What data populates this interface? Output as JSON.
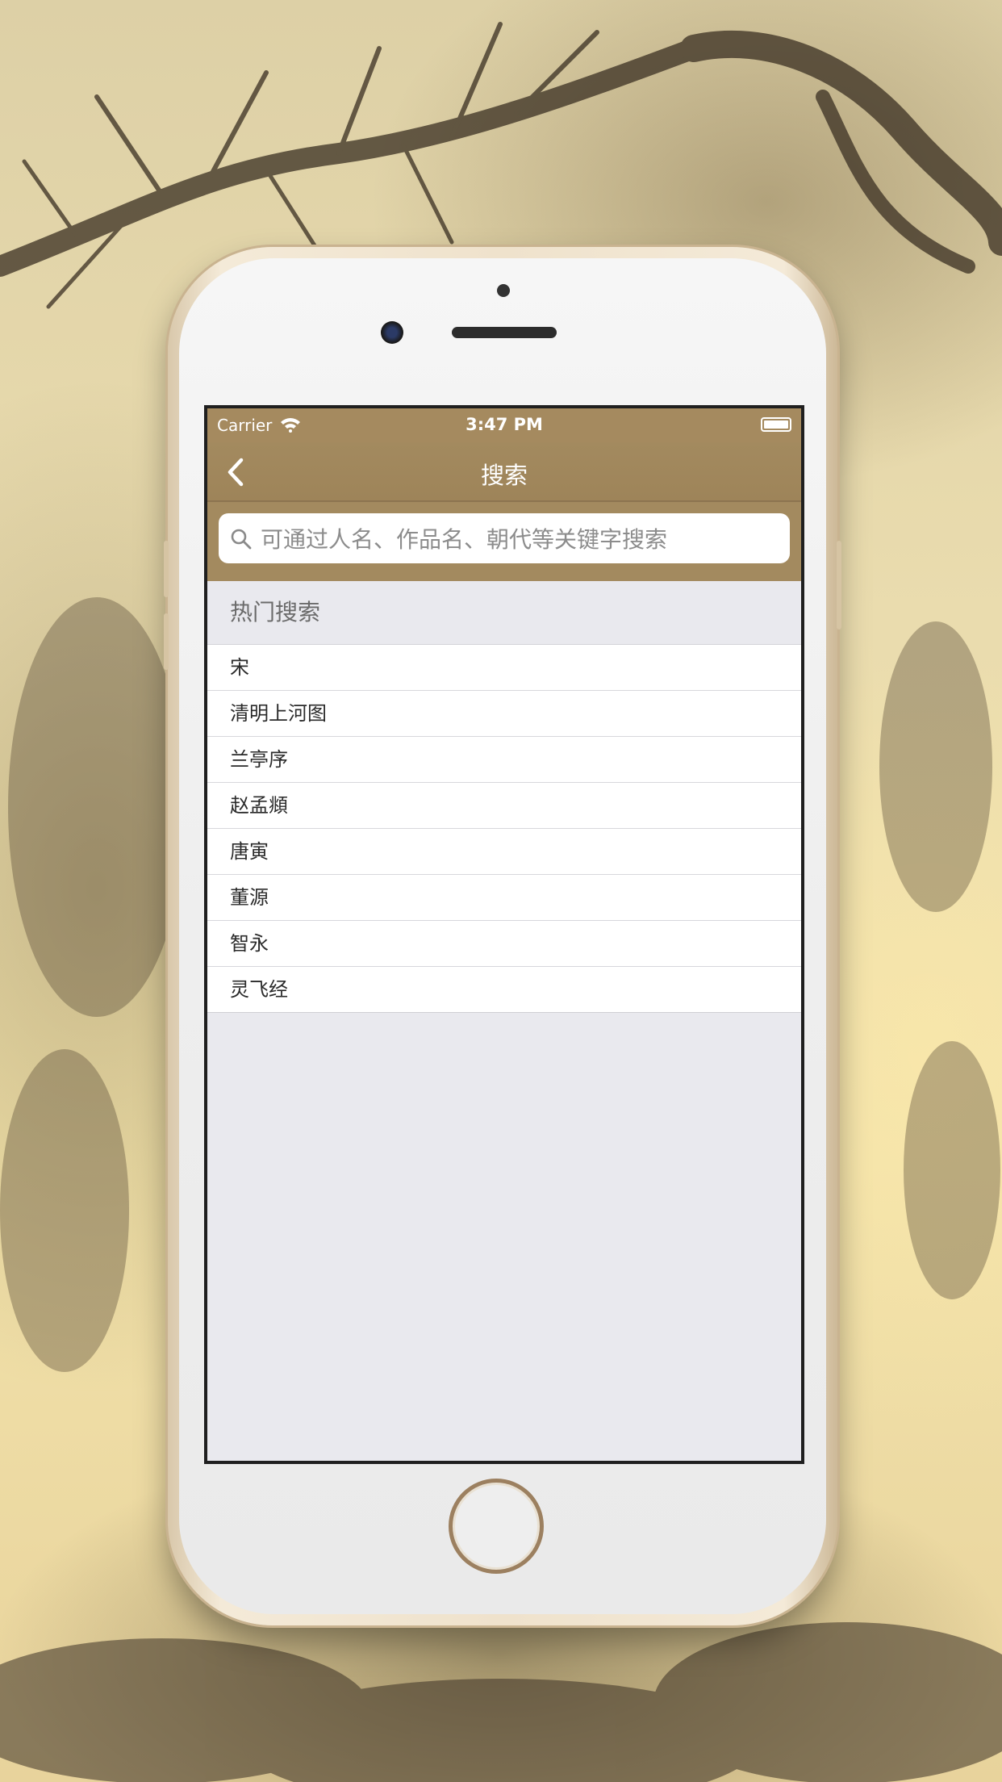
{
  "status_bar": {
    "carrier": "Carrier",
    "time": "3:47 PM"
  },
  "nav": {
    "title": "搜索",
    "back_icon": "chevron-left-icon"
  },
  "search": {
    "placeholder": "可通过人名、作品名、朝代等关键字搜索",
    "value": "",
    "icon": "search-icon"
  },
  "hot_section": {
    "title": "热门搜索",
    "items": [
      {
        "label": "宋"
      },
      {
        "label": "清明上河图"
      },
      {
        "label": "兰亭序"
      },
      {
        "label": "赵孟頫"
      },
      {
        "label": "唐寅"
      },
      {
        "label": "董源"
      },
      {
        "label": "智永"
      },
      {
        "label": "灵飞经"
      }
    ]
  },
  "colors": {
    "nav_background": "#a38a5f",
    "list_background": "#ffffff",
    "page_background": "#e9e9ee"
  }
}
